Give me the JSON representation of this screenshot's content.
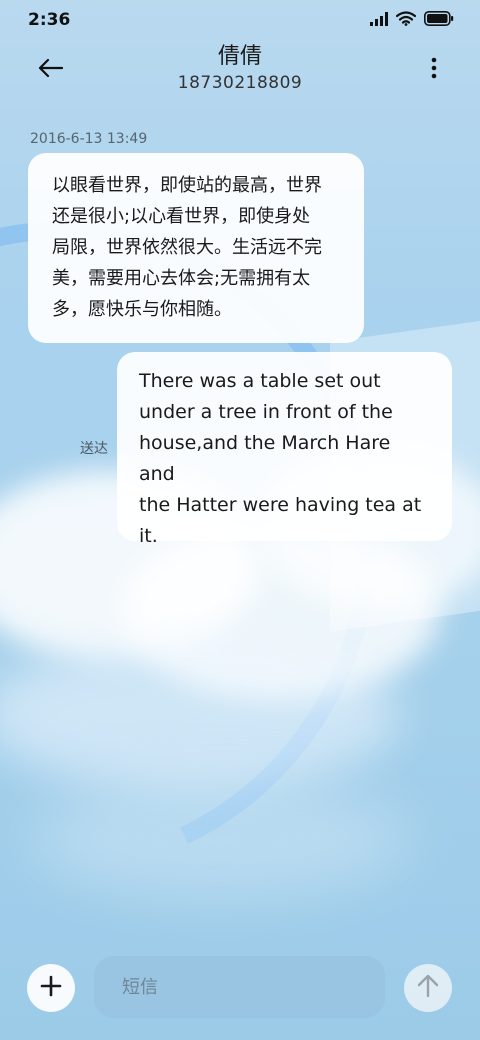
{
  "status_bar": {
    "time": "2:36",
    "icons": [
      "signal-icon",
      "wifi-icon",
      "battery-icon"
    ]
  },
  "header": {
    "contact_name": "倩倩",
    "phone_number": "18730218809",
    "back_icon": "back-arrow-icon",
    "more_icon": "more-vertical-icon"
  },
  "conversation": {
    "timestamp": "2016-6-13 13:49",
    "messages": [
      {
        "direction": "received",
        "lines": [
          "以眼看世界，即使站的最高，世界",
          "还是很小;以心看世界，即使身处",
          "局限，世界依然很大。生活远不完",
          "美，需要用心去体会;无需拥有太",
          "多，愿快乐与你相随。"
        ]
      },
      {
        "direction": "sent",
        "lines": [
          "There was a table set out",
          "under a tree in front of the",
          "house,and the March Hare and",
          "the Hatter were having tea at",
          "it."
        ],
        "status": "送达"
      }
    ]
  },
  "composer": {
    "placeholder": "短信",
    "add_icon": "plus-icon",
    "send_icon": "arrow-up-icon"
  },
  "colors": {
    "background": "#a9d2ee",
    "bubble": "#ffffff",
    "text": "#1a1a1a"
  }
}
